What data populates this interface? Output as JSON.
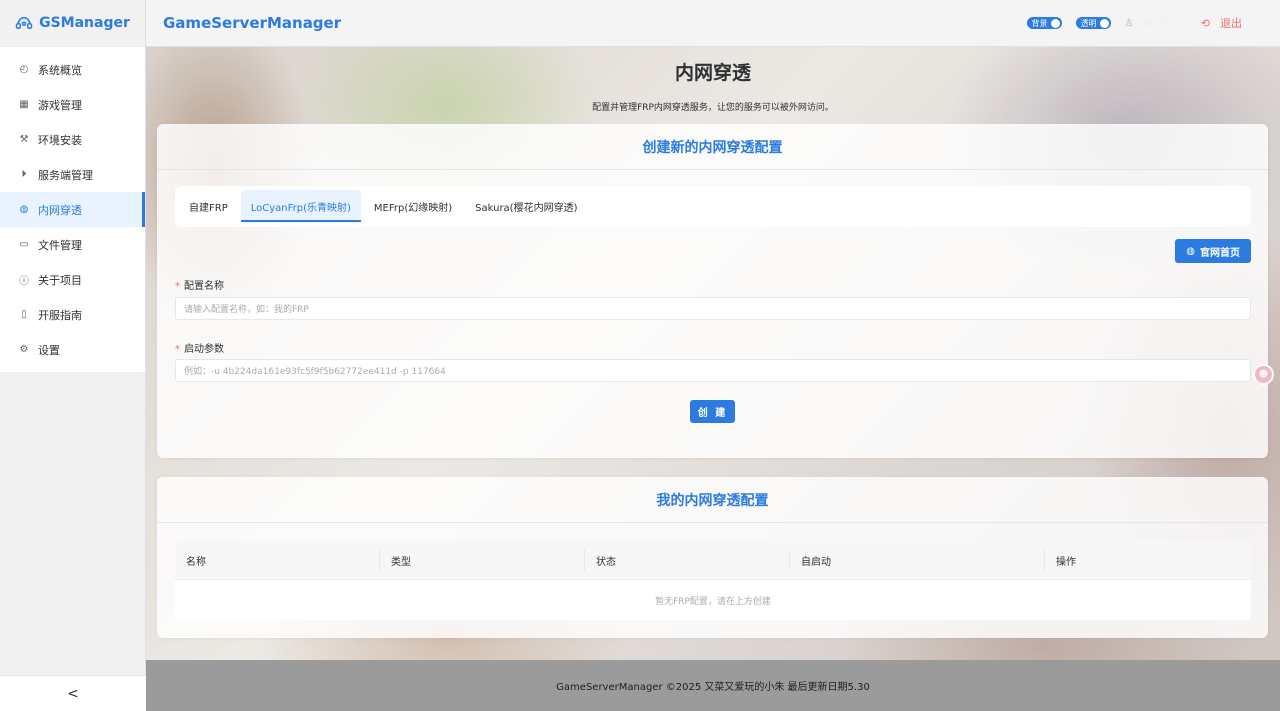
{
  "app": {
    "logo_text": "GSManager",
    "header_title": "GameServerManager"
  },
  "header": {
    "toggle_background": "背景",
    "toggle_transparent": "透明",
    "username": "panda",
    "logout": "退出"
  },
  "sidebar": {
    "items": [
      {
        "label": "系统概览",
        "icon": "dashboard-icon"
      },
      {
        "label": "游戏管理",
        "icon": "grid-icon"
      },
      {
        "label": "环境安装",
        "icon": "wrench-icon"
      },
      {
        "label": "服务端管理",
        "icon": "play-circle-icon"
      },
      {
        "label": "内网穿透",
        "icon": "globe-icon",
        "active": true
      },
      {
        "label": "文件管理",
        "icon": "folder-icon"
      },
      {
        "label": "关于项目",
        "icon": "info-icon"
      },
      {
        "label": "开服指南",
        "icon": "document-icon"
      },
      {
        "label": "设置",
        "icon": "gear-icon"
      }
    ],
    "collapse": "<"
  },
  "page": {
    "title": "内网穿透",
    "subtitle": "配置并管理FRP内网穿透服务，让您的服务可以被外网访问。"
  },
  "create_card": {
    "title": "创建新的内网穿透配置",
    "tabs": [
      "自建FRP",
      "LoCyanFrp(乐青映射)",
      "MEFrp(幻缘映射)",
      "Sakura(樱花内网穿透)"
    ],
    "active_tab": 1,
    "site_button": "官网首页",
    "name_label": "配置名称",
    "name_placeholder": "请输入配置名称，如：我的FRP",
    "args_label": "启动参数",
    "args_placeholder": "例如：-u 4b224da161e93fc5f9f5b62772ee411d -p 117664",
    "create_button": "创 建"
  },
  "list_card": {
    "title": "我的内网穿透配置",
    "columns": [
      "名称",
      "类型",
      "状态",
      "自启动",
      "操作"
    ],
    "empty_text": "暂无FRP配置，请在上方创建"
  },
  "footer": {
    "text": "GameServerManager ©2025 又菜又爱玩的小朱 最后更新日期5.30"
  },
  "colors": {
    "accent": "#2b7be0",
    "danger": "#f56c6c"
  }
}
